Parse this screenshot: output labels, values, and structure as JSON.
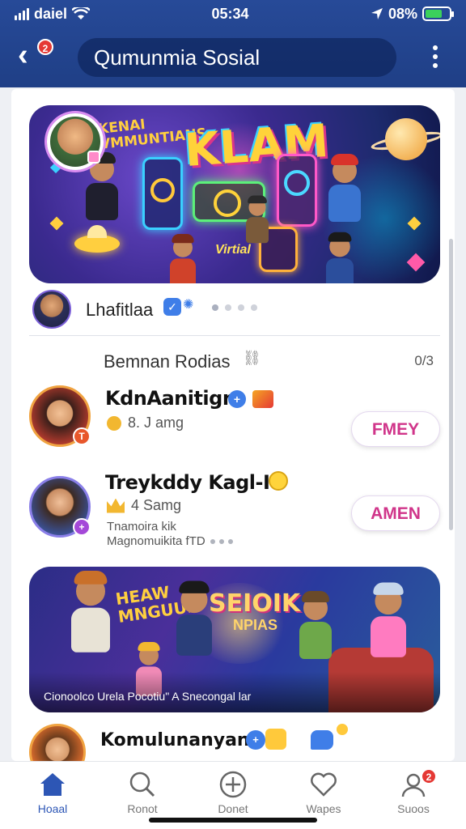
{
  "status_bar": {
    "carrier": "daiel",
    "time": "05:34",
    "battery": "08%",
    "battery_level": 0.7
  },
  "header": {
    "title": "Qumunmia Sosial",
    "back_badge": "2"
  },
  "hero": {
    "small_text": "KENAI\nVMMUNTIANS",
    "big_text": "KLAM",
    "sub_text": "Virtial"
  },
  "post_meta": {
    "name": "Lhafitlaa",
    "page_indicator": {
      "count": 4,
      "active": 0
    }
  },
  "section": {
    "title": "Bemnan Rodias",
    "count": "0/3"
  },
  "members": [
    {
      "name": "KdnAanitign",
      "sub": "8. J amg",
      "button": "FMEY"
    },
    {
      "name": "Treykddy Kagl-I",
      "sub": "4 Samg",
      "desc_line1": "Tnamoira kik",
      "desc_line2": "Magnomuikita fTD",
      "button": "AMEN"
    }
  ],
  "banner2": {
    "left_text": "HEAW\nMNGUUN",
    "title": "SEIOIK",
    "subtitle": "NPIAS",
    "caption": "Cionoolco Urela Pocotiu\"  A Snecongal lar"
  },
  "last_post": {
    "name": "Komulunanyan"
  },
  "tabs": [
    {
      "label": "Hoaal",
      "icon": "home-icon",
      "active": true
    },
    {
      "label": "Ronot",
      "icon": "search-icon",
      "active": false
    },
    {
      "label": "Donet",
      "icon": "add-icon",
      "active": false
    },
    {
      "label": "Wapes",
      "icon": "heart-icon",
      "active": false
    },
    {
      "label": "Suoos",
      "icon": "profile-icon",
      "active": false,
      "badge": "2"
    }
  ],
  "colors": {
    "header_bg": "#274a98",
    "accent_pink": "#d0358a",
    "verify_blue": "#3f7ee8",
    "tab_active": "#2d56b5"
  }
}
